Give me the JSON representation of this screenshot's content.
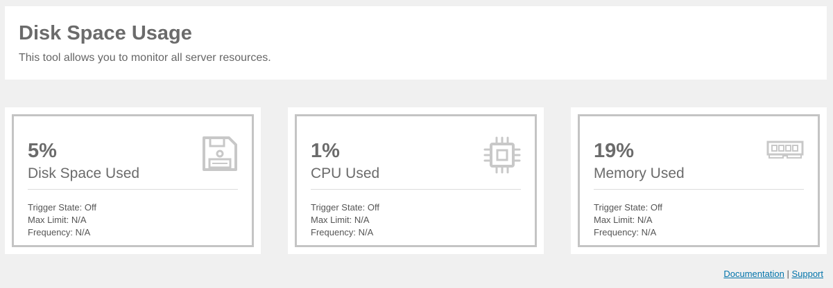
{
  "page": {
    "title": "Disk Space Usage",
    "description": "This tool allows you to monitor all server resources."
  },
  "cards": [
    {
      "value": "5%",
      "label": "Disk Space Used",
      "icon": "floppy-disk-icon",
      "trigger": "Trigger State: Off",
      "max_limit": "Max Limit: N/A",
      "frequency": "Frequency: N/A"
    },
    {
      "value": "1%",
      "label": "CPU Used",
      "icon": "cpu-chip-icon",
      "trigger": "Trigger State: Off",
      "max_limit": "Max Limit: N/A",
      "frequency": "Frequency: N/A"
    },
    {
      "value": "19%",
      "label": "Memory Used",
      "icon": "memory-module-icon",
      "trigger": "Trigger State: Off",
      "max_limit": "Max Limit: N/A",
      "frequency": "Frequency: N/A"
    }
  ],
  "footer": {
    "documentation": "Documentation",
    "separator": "|",
    "support": "Support"
  },
  "colors": {
    "background": "#f0f0f0",
    "panel": "#ffffff",
    "card_border": "#c4c4c4",
    "icon": "#c8c8c8",
    "link": "#0073aa"
  }
}
